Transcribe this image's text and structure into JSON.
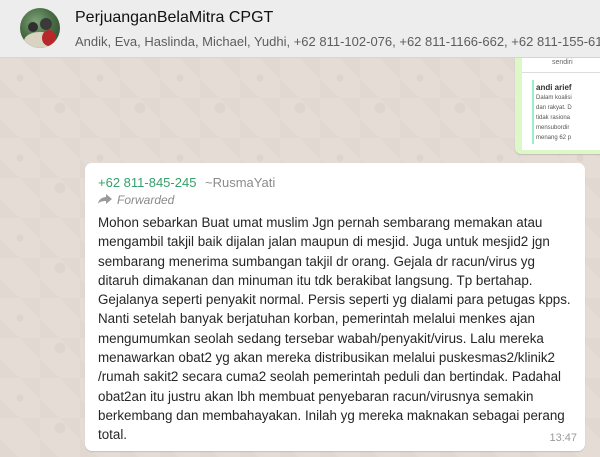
{
  "header": {
    "title": "PerjuanganBelaMitra CPGT",
    "members": "Andik, Eva, Haslinda, Michael, Yudhi, +62 811-102-076, +62 811-1166-662, +62 811-155-61"
  },
  "quoted_image": {
    "top_text": "sendiri",
    "name": "andi arief",
    "lines": [
      "Dalam koalisi",
      "dan rakyat. D",
      "tidak rasiona",
      "mensubordir",
      "menang 62 p"
    ]
  },
  "message": {
    "sender_number": "+62 811-845-245",
    "sender_name": "~RusmaYati",
    "forwarded_label": "Forwarded",
    "lines": [
      "Mohon sebarkan Buat umat muslim Jgn pernah sembarang memakan atau",
      "mengambil takjil baik dijalan jalan maupun di mesjid. Juga untuk mesjid2 jgn",
      "sembarang menerima sumbangan takjil dr orang. Gejala dr racun/virus yg",
      "ditaruh dimakanan dan minuman itu tdk berakibat langsung. Tp bertahap.",
      "Gejalanya seperti penyakit normal. Persis seperti yg dialami para petugas kpps.",
      "Nanti setelah banyak berjatuhan korban, pemerintah melalui menkes ajan",
      "mengumumkan seolah sedang tersebar wabah/penyakit/virus. Lalu mereka",
      "menawarkan obat2 yg akan mereka distribusikan melalui puskesmas2/klinik2",
      "/rumah sakit2 secara cuma2 seolah pemerintah peduli dan bertindak. Padahal",
      "obat2an itu justru akan lbh membuat penyebaran racun/virusnya semakin",
      "berkembang dan membahayakan. Inilah yg mereka maknakan sebagai perang",
      "total."
    ],
    "time": "13:47"
  }
}
